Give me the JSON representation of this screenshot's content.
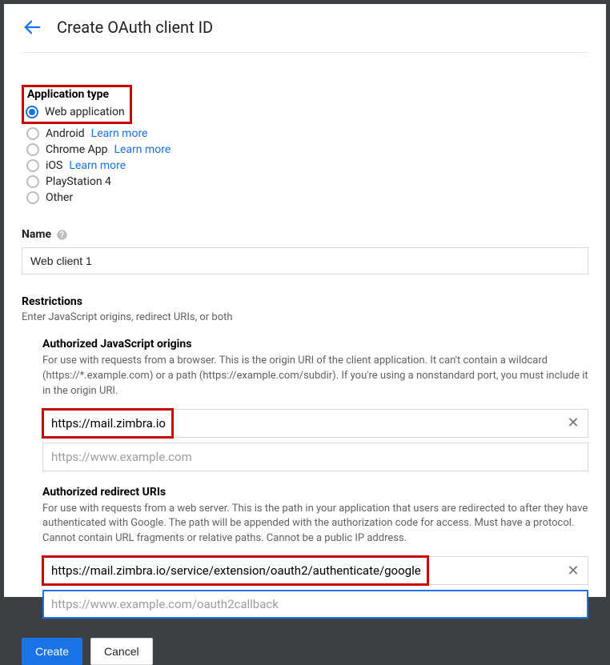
{
  "header": {
    "title": "Create OAuth client ID"
  },
  "app_type": {
    "label": "Application type",
    "options": [
      {
        "label": "Web application",
        "selected": true,
        "learn_more": ""
      },
      {
        "label": "Android",
        "selected": false,
        "learn_more": "Learn more"
      },
      {
        "label": "Chrome App",
        "selected": false,
        "learn_more": "Learn more"
      },
      {
        "label": "iOS",
        "selected": false,
        "learn_more": "Learn more"
      },
      {
        "label": "PlayStation 4",
        "selected": false,
        "learn_more": ""
      },
      {
        "label": "Other",
        "selected": false,
        "learn_more": ""
      }
    ]
  },
  "name_field": {
    "label": "Name",
    "value": "Web client 1"
  },
  "restrictions": {
    "title": "Restrictions",
    "subtitle": "Enter JavaScript origins, redirect URIs, or both",
    "js_origins": {
      "title": "Authorized JavaScript origins",
      "desc": "For use with requests from a browser. This is the origin URI of the client application. It can't contain a wildcard (https://*.example.com) or a path (https://example.com/subdir). If you're using a nonstandard port, you must include it in the origin URI.",
      "value": "https://mail.zimbra.io",
      "placeholder": "https://www.example.com"
    },
    "redirect_uris": {
      "title": "Authorized redirect URIs",
      "desc": "For use with requests from a web server. This is the path in your application that users are redirected to after they have authenticated with Google. The path will be appended with the authorization code for access. Must have a protocol. Cannot contain URL fragments or relative paths. Cannot be a public IP address.",
      "value": "https://mail.zimbra.io/service/extension/oauth2/authenticate/google",
      "placeholder": "https://www.example.com/oauth2callback"
    }
  },
  "actions": {
    "create": "Create",
    "cancel": "Cancel"
  },
  "highlight_color": "#cc0100"
}
